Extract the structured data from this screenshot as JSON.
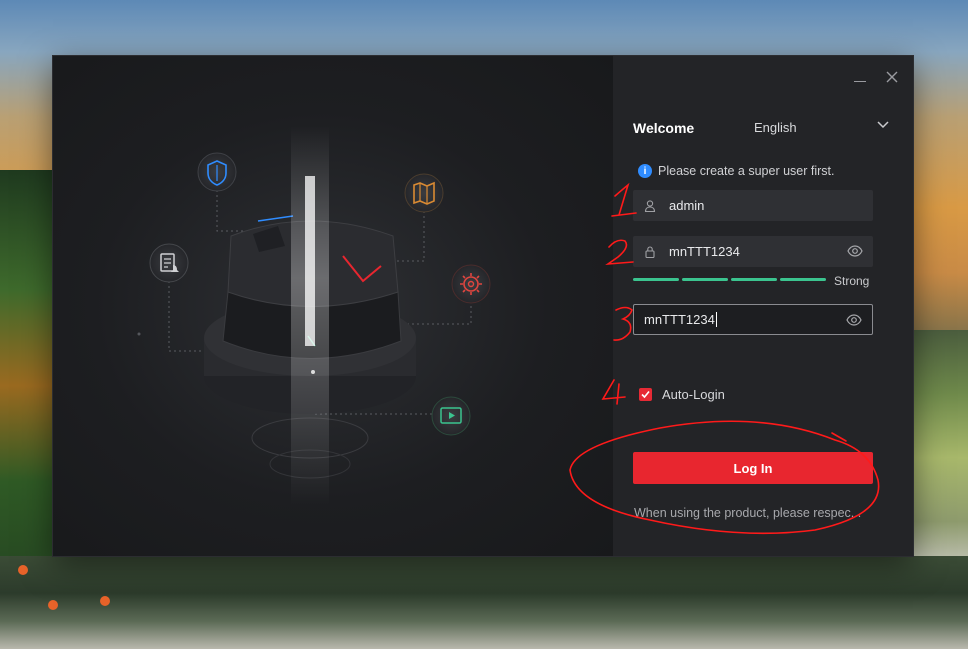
{
  "window": {
    "controls": {
      "minimize_icon": "minimize-icon",
      "close_icon": "close-icon"
    }
  },
  "header": {
    "title": "Welcome",
    "language": "English",
    "language_icon": "chevron-down-icon"
  },
  "info": {
    "icon": "info-icon",
    "text": "Please create a super user first."
  },
  "form": {
    "username": {
      "value": "admin",
      "icon": "user-icon"
    },
    "password": {
      "value": "mnTTT1234",
      "icon": "lock-icon",
      "toggle_icon": "eye-icon"
    },
    "confirm_password": {
      "value": "mnTTT1234",
      "toggle_icon": "eye-icon"
    },
    "strength": {
      "label": "Strong",
      "level": 4,
      "max": 4,
      "color": "#3bc48f"
    },
    "auto_login": {
      "label": "Auto-Login",
      "checked": true
    }
  },
  "actions": {
    "login_label": "Log In"
  },
  "footer": {
    "notice": "When using the product, please respec..."
  },
  "hero": {
    "icons": [
      "shield-icon",
      "map-icon",
      "document-bell-icon",
      "gear-icon",
      "video-icon"
    ]
  },
  "annotations": {
    "color": "#ff1a1a",
    "marks": [
      "1",
      "2",
      "3",
      "4"
    ]
  },
  "colors": {
    "accent": "#e8262f",
    "strength": "#3bc48f",
    "info": "#2f8cff"
  }
}
